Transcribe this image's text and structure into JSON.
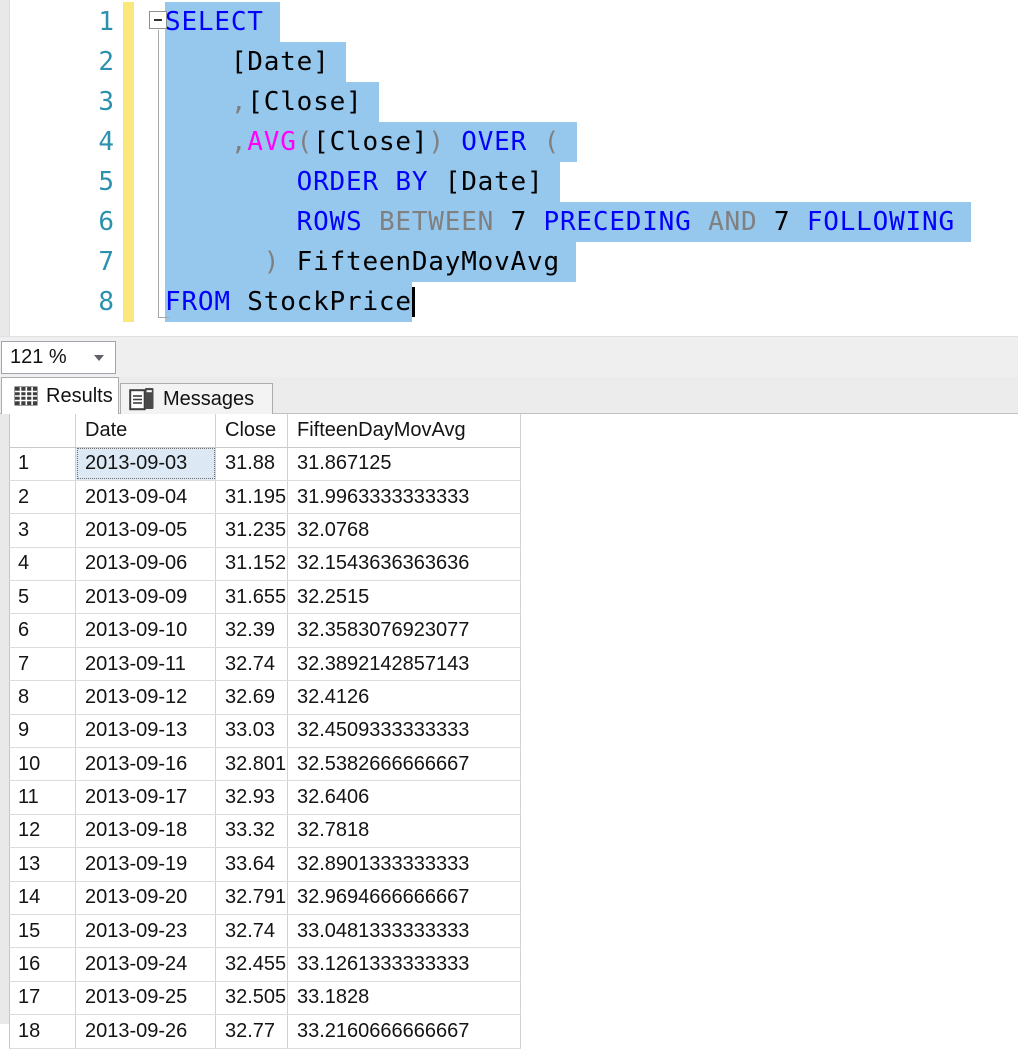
{
  "colors": {
    "keyword": "#0000FF",
    "function": "#FF00FF",
    "operator_gray": "#808080",
    "plain_text": "#000000",
    "selection_background": "#96C7EC",
    "line_number": "#2B91AF",
    "change_bar_yellow": "#FBE87D"
  },
  "editor": {
    "lines": [
      {
        "num": "1",
        "fold": true,
        "tokens": [
          [
            "SELECT",
            "kw"
          ]
        ]
      },
      {
        "num": "2",
        "tokens": [
          [
            "    [Date]",
            "pl"
          ]
        ]
      },
      {
        "num": "3",
        "tokens": [
          [
            "    ",
            "pl"
          ],
          [
            ",",
            "op"
          ],
          [
            "[Close]",
            "pl"
          ]
        ]
      },
      {
        "num": "4",
        "tokens": [
          [
            "    ",
            "pl"
          ],
          [
            ",",
            "op"
          ],
          [
            "AVG",
            "fn"
          ],
          [
            "(",
            "op"
          ],
          [
            "[Close]",
            "pl"
          ],
          [
            ")",
            "op"
          ],
          [
            " ",
            "pl"
          ],
          [
            "OVER",
            "kw"
          ],
          [
            " ",
            "pl"
          ],
          [
            "(",
            "op"
          ]
        ]
      },
      {
        "num": "5",
        "tokens": [
          [
            "        ",
            "pl"
          ],
          [
            "ORDER BY",
            "kw"
          ],
          [
            " [Date]",
            "pl"
          ]
        ]
      },
      {
        "num": "6",
        "tokens": [
          [
            "        ",
            "pl"
          ],
          [
            "ROWS",
            "kw"
          ],
          [
            " ",
            "pl"
          ],
          [
            "BETWEEN",
            "op"
          ],
          [
            " 7 ",
            "pl"
          ],
          [
            "PRECEDING",
            "kw"
          ],
          [
            " ",
            "pl"
          ],
          [
            "AND",
            "op"
          ],
          [
            " 7 ",
            "pl"
          ],
          [
            "FOLLOWING",
            "kw"
          ]
        ]
      },
      {
        "num": "7",
        "tokens": [
          [
            "      ",
            "pl"
          ],
          [
            ")",
            "op"
          ],
          [
            " FifteenDayMovAvg",
            "pl"
          ]
        ]
      },
      {
        "num": "8",
        "caret": true,
        "no_trail": true,
        "tokens": [
          [
            "FROM",
            "kw"
          ],
          [
            " StockPrice",
            "pl"
          ]
        ]
      }
    ]
  },
  "zoom_control": {
    "value": "121 %"
  },
  "tabs": [
    {
      "label": "Results",
      "active": true
    },
    {
      "label": "Messages",
      "active": false
    }
  ],
  "grid": {
    "columns": [
      "",
      "Date",
      "Close",
      "FifteenDayMovAvg"
    ],
    "selected_cell": {
      "row_index": 0,
      "col_index": 1
    },
    "rows": [
      [
        "1",
        "2013-09-03",
        "31.88",
        "31.867125"
      ],
      [
        "2",
        "2013-09-04",
        "31.195",
        "31.9963333333333"
      ],
      [
        "3",
        "2013-09-05",
        "31.235",
        "32.0768"
      ],
      [
        "4",
        "2013-09-06",
        "31.152",
        "32.1543636363636"
      ],
      [
        "5",
        "2013-09-09",
        "31.655",
        "32.2515"
      ],
      [
        "6",
        "2013-09-10",
        "32.39",
        "32.3583076923077"
      ],
      [
        "7",
        "2013-09-11",
        "32.74",
        "32.3892142857143"
      ],
      [
        "8",
        "2013-09-12",
        "32.69",
        "32.4126"
      ],
      [
        "9",
        "2013-09-13",
        "33.03",
        "32.4509333333333"
      ],
      [
        "10",
        "2013-09-16",
        "32.801",
        "32.5382666666667"
      ],
      [
        "11",
        "2013-09-17",
        "32.93",
        "32.6406"
      ],
      [
        "12",
        "2013-09-18",
        "33.32",
        "32.7818"
      ],
      [
        "13",
        "2013-09-19",
        "33.64",
        "32.8901333333333"
      ],
      [
        "14",
        "2013-09-20",
        "32.791",
        "32.9694666666667"
      ],
      [
        "15",
        "2013-09-23",
        "32.74",
        "33.0481333333333"
      ],
      [
        "16",
        "2013-09-24",
        "32.455",
        "33.1261333333333"
      ],
      [
        "17",
        "2013-09-25",
        "32.505",
        "33.1828"
      ],
      [
        "18",
        "2013-09-26",
        "32.77",
        "33.2160666666667"
      ]
    ]
  }
}
